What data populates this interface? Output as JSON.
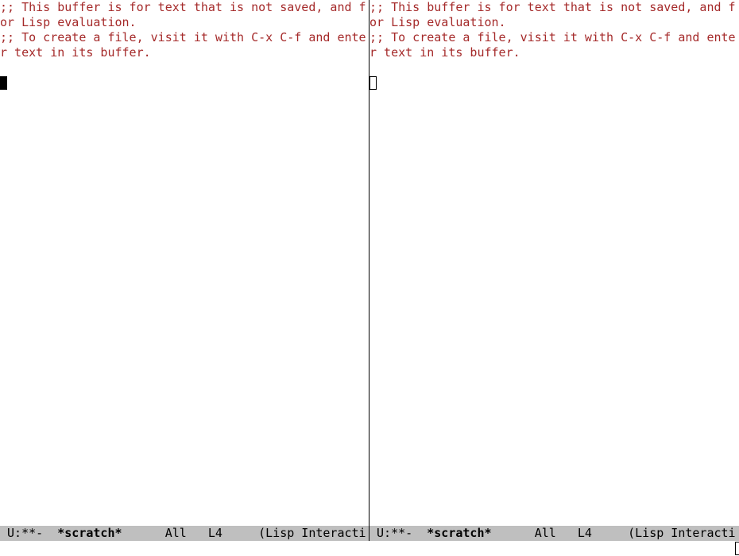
{
  "colors": {
    "comment": "#a52a2a",
    "modeline_bg": "#bfbfbf",
    "modeline_fg": "#000000",
    "bg": "#ffffff"
  },
  "left": {
    "lines": [
      ";; This buffer is for text that is not saved, and f",
      "or Lisp evaluation.",
      ";; To create a file, visit it with C-x C-f and ente",
      "r text in its buffer.",
      ""
    ],
    "modeline": {
      "left": " U:**-  ",
      "buffer": "*scratch*",
      "mid": "      All   L4     (Lisp Interacti"
    },
    "active": true
  },
  "right": {
    "lines": [
      ";; This buffer is for text that is not saved, and f",
      "or Lisp evaluation.",
      ";; To create a file, visit it with C-x C-f and ente",
      "r text in its buffer.",
      ""
    ],
    "modeline": {
      "left": " U:**-  ",
      "buffer": "*scratch*",
      "mid": "      All   L4     (Lisp Interacti"
    },
    "active": false
  },
  "minibuffer": ""
}
